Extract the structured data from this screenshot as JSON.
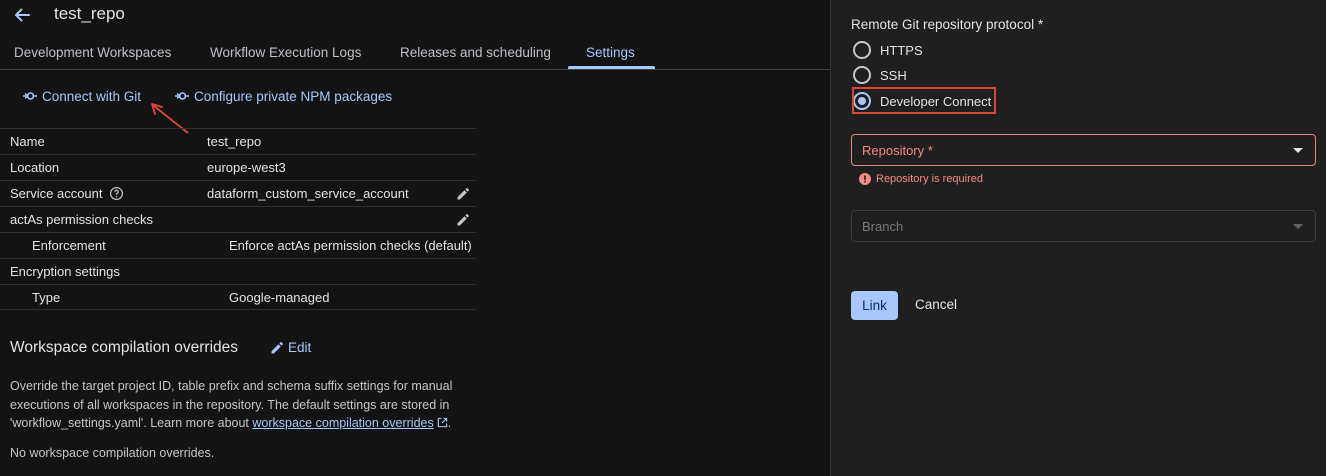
{
  "header": {
    "title": "test_repo"
  },
  "tabs": [
    {
      "label": "Development Workspaces"
    },
    {
      "label": "Workflow Execution Logs"
    },
    {
      "label": "Releases and scheduling"
    },
    {
      "label": "Settings"
    }
  ],
  "active_tab": "Settings",
  "actions": {
    "connect_git": "Connect with Git",
    "configure_npm": "Configure private NPM packages"
  },
  "properties": [
    {
      "key": "Name",
      "value": "test_repo"
    },
    {
      "key": "Location",
      "value": "europe-west3"
    },
    {
      "key": "Service account",
      "value": "dataform_custom_service_account"
    },
    {
      "key": "actAs permission checks",
      "value": ""
    },
    {
      "key": "Enforcement",
      "value": "Enforce actAs permission checks (default)"
    },
    {
      "key": "Encryption settings",
      "value": ""
    },
    {
      "key": "Type",
      "value": "Google-managed"
    }
  ],
  "overrides": {
    "title": "Workspace compilation overrides",
    "edit_label": "Edit",
    "description": "Override the target project ID, table prefix and schema suffix settings for manual executions of all workspaces in the repository. The default settings are stored in 'workflow_settings.yaml'. Learn more about ",
    "link_text": "workspace compilation overrides",
    "description_end": ".",
    "none_text": "No workspace compilation overrides."
  },
  "panel": {
    "protocol_label": "Remote Git repository protocol *",
    "options": [
      {
        "label": "HTTPS",
        "checked": false
      },
      {
        "label": "SSH",
        "checked": false
      },
      {
        "label": "Developer Connect",
        "checked": true
      }
    ],
    "repository_placeholder": "Repository *",
    "repository_error": "Repository is required",
    "branch_placeholder": "Branch",
    "link_button": "Link",
    "cancel_button": "Cancel"
  },
  "colors": {
    "accent": "#a8c7fa",
    "error": "#f28b82",
    "highlight_box": "#d9473b",
    "annotation_arrow": "#e0473a"
  },
  "icons": {
    "back": "arrow-left-icon",
    "git": "git-commit-icon",
    "help": "help-circle-icon",
    "edit": "pencil-icon",
    "external": "external-link-icon",
    "error": "error-circle-icon"
  }
}
